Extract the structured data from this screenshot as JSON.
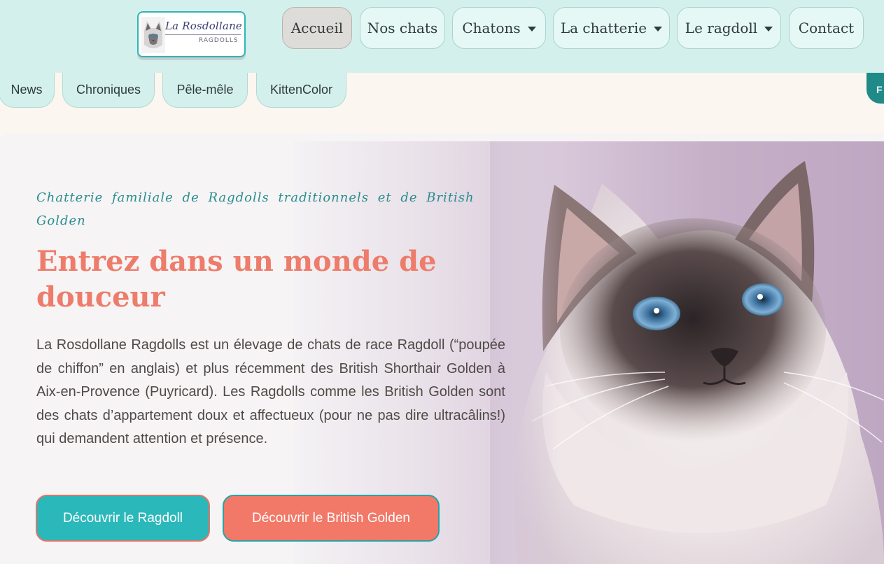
{
  "header": {
    "logo": {
      "brand": "La Rosdollane",
      "sub": "RAGDOLLS",
      "icon": "cat-face-icon"
    },
    "nav": [
      {
        "label": "Accueil",
        "active": true,
        "dropdown": false
      },
      {
        "label": "Nos chats",
        "active": false,
        "dropdown": false
      },
      {
        "label": "Chatons",
        "active": false,
        "dropdown": true
      },
      {
        "label": "La chatterie",
        "active": false,
        "dropdown": true
      },
      {
        "label": "Le ragdoll",
        "active": false,
        "dropdown": true
      },
      {
        "label": "Contact",
        "active": false,
        "dropdown": false
      }
    ]
  },
  "subnav": {
    "items": [
      "News",
      "Chroniques",
      "Pêle-mêle",
      "KittenColor"
    ],
    "side_tab_label": "F"
  },
  "hero": {
    "tagline": "Chatterie familiale de Ragdolls traditionnels et de British Golden",
    "headline": "Entrez dans un monde de douceur",
    "intro": "La Rosdollane Ragdolls est un élevage de chats de race Ragdoll (“poupée de chiffon” en anglais) et plus récemment des British Shorthair Golden à Aix-en-Provence (Puyricard). Les Ragdolls comme les British Golden sont des chats d’appartement doux et affectueux (pour ne pas dire ultracâlins!) qui demandent attention et présence.",
    "buttons": {
      "ragdoll": "Découvrir le Ragdoll",
      "british": "Découvrir le British Golden"
    }
  },
  "colors": {
    "header_bg": "#d4f0ec",
    "accent_teal": "#2bb8bb",
    "accent_coral": "#f27867",
    "headline": "#ee7c6b",
    "tagline": "#2a8d8f"
  }
}
